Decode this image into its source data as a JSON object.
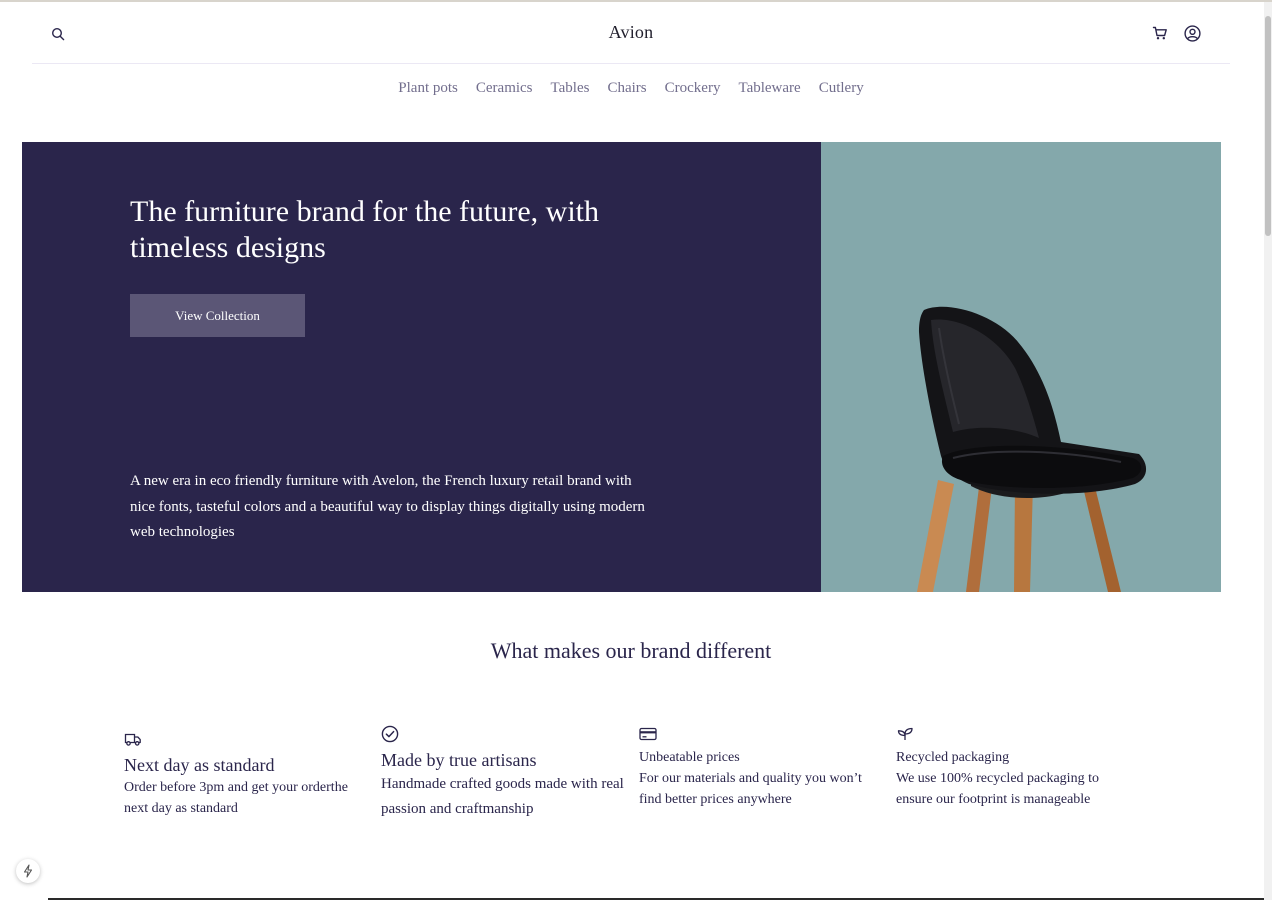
{
  "header": {
    "brand": "Avion",
    "icons": {
      "search": "search-icon",
      "cart": "cart-icon",
      "account": "user-circle-icon"
    }
  },
  "nav": {
    "items": [
      "Plant pots",
      "Ceramics",
      "Tables",
      "Chairs",
      "Crockery",
      "Tableware",
      "Cutlery"
    ]
  },
  "hero": {
    "title": "The furniture brand for the future, with timeless designs",
    "button_label": "View Collection",
    "description": "A new era in eco friendly furniture with Avelon, the French luxury retail brand with nice fonts, tasteful colors and a beautiful way to display things digitally using modern web technologies",
    "image": "black-chair-image"
  },
  "features": {
    "title": "What makes our brand different",
    "items": [
      {
        "icon": "delivery-truck-icon",
        "heading": "Next day as standard",
        "body": "Order before 3pm and get your orderthe next day as standard"
      },
      {
        "icon": "check-circle-icon",
        "heading": "Made by true artisans",
        "body": "Handmade crafted goods made with real passion and craftmanship"
      },
      {
        "icon": "credit-card-icon",
        "heading": "Unbeatable prices",
        "body": "For our materials and quality you won’t find better prices anywhere"
      },
      {
        "icon": "sprout-icon",
        "heading": "Recycled packaging",
        "body": "We use 100% recycled packaging to ensure our footprint is manageable"
      }
    ]
  },
  "colors": {
    "primary": "#2a254b",
    "button": "#5b5676",
    "hero_image_bg": "#84a8ab",
    "nav_text": "#726e8d"
  }
}
